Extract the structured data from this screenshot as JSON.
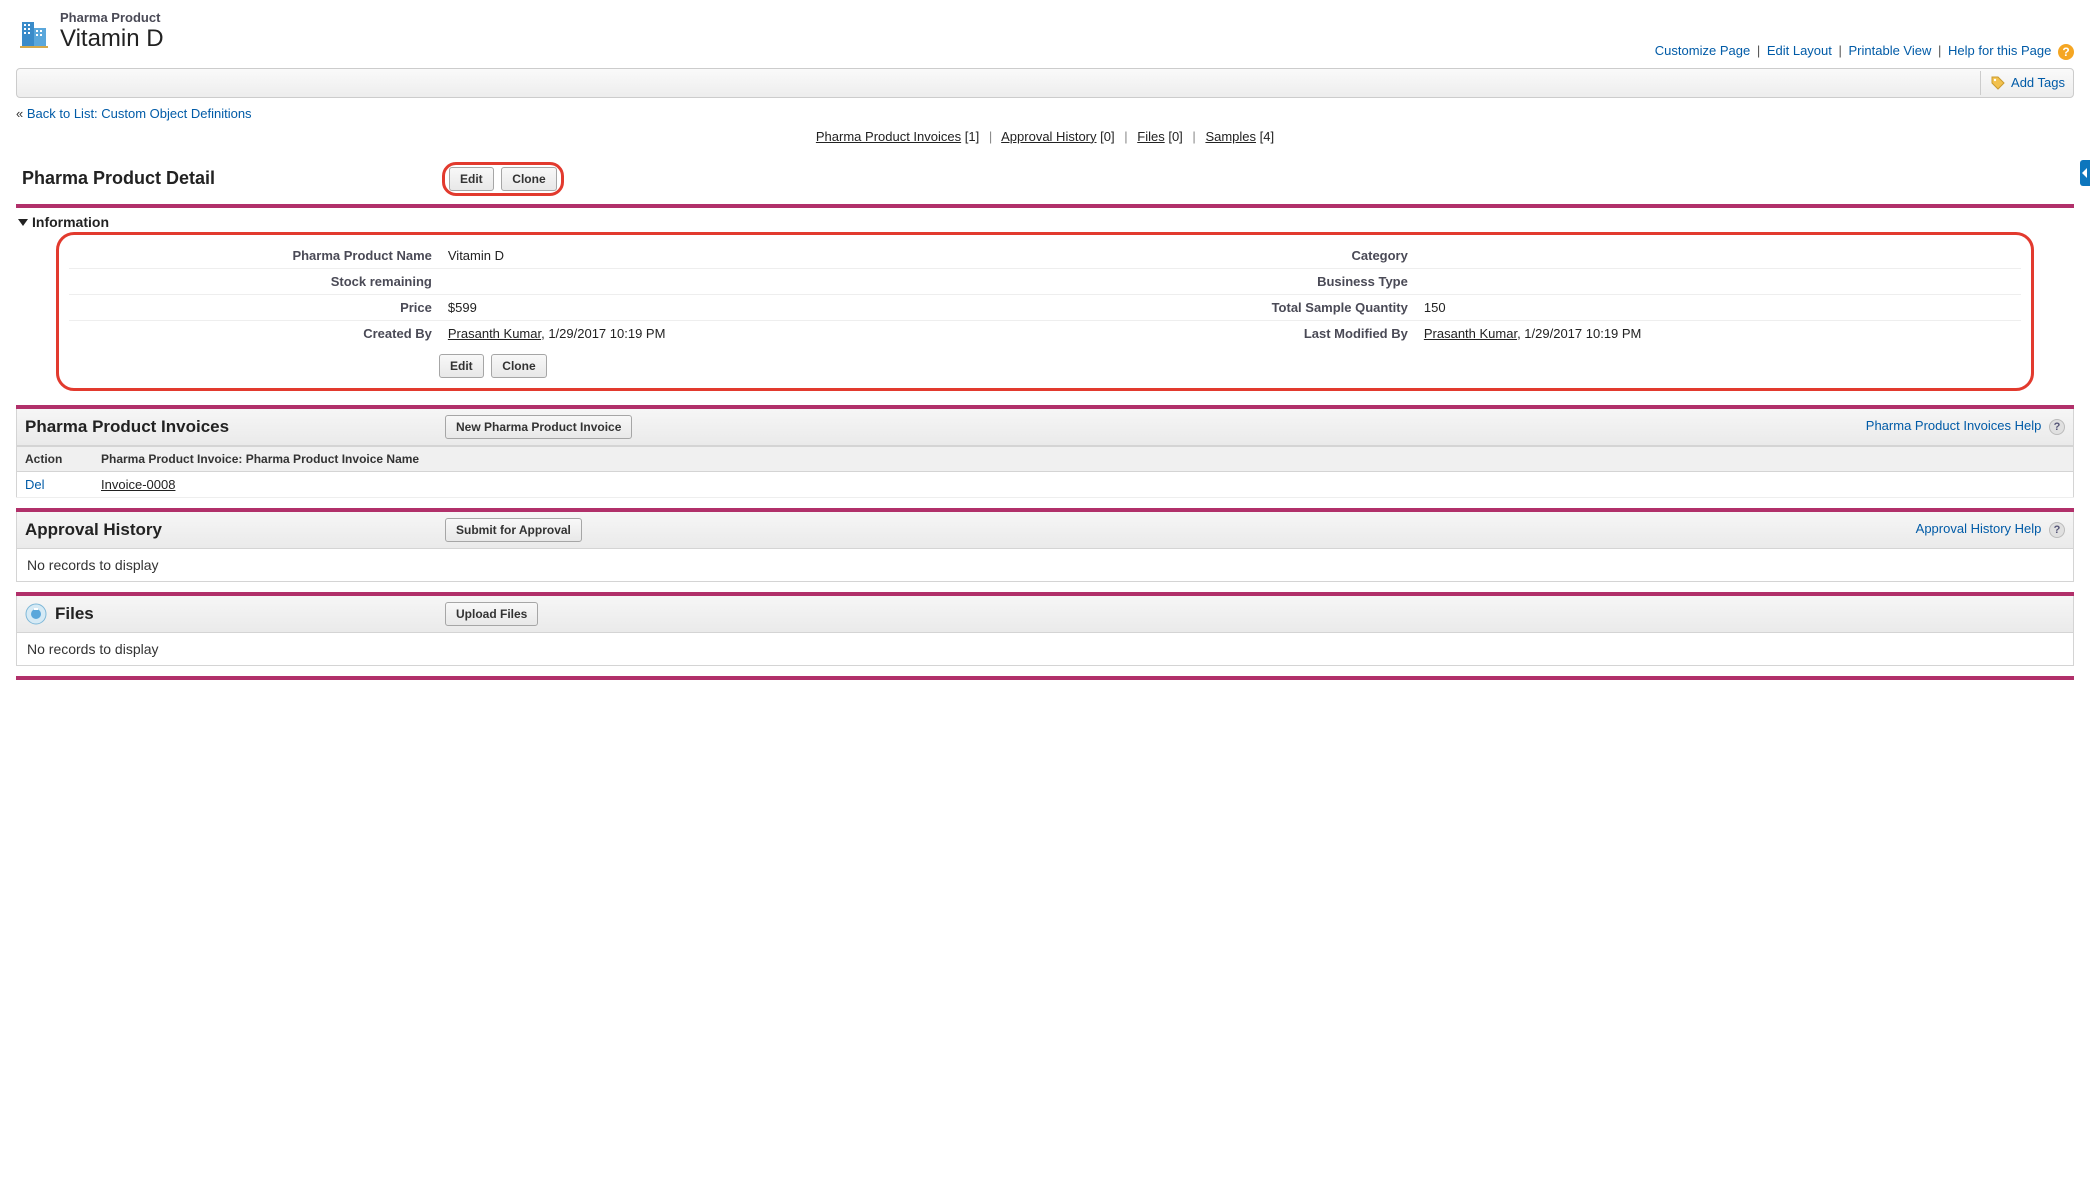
{
  "header": {
    "object_type": "Pharma Product",
    "record_name": "Vitamin D"
  },
  "top_links": {
    "customize": "Customize Page",
    "edit_layout": "Edit Layout",
    "printable": "Printable View",
    "help_page": "Help for this Page"
  },
  "tagbar": {
    "add_tags": "Add Tags"
  },
  "back_link": {
    "prefix": "«",
    "label": "Back to List: Custom Object Definitions"
  },
  "related_nav": [
    {
      "label": "Pharma Product Invoices",
      "count": "[1]"
    },
    {
      "label": "Approval History",
      "count": "[0]"
    },
    {
      "label": "Files",
      "count": "[0]"
    },
    {
      "label": "Samples",
      "count": "[4]"
    }
  ],
  "detail": {
    "section_title": "Pharma Product Detail",
    "edit_label": "Edit",
    "clone_label": "Clone",
    "info_header": "Information",
    "fields": {
      "name_label": "Pharma Product Name",
      "name_value": "Vitamin D",
      "category_label": "Category",
      "category_value": "",
      "stock_label": "Stock remaining",
      "stock_value": "",
      "biztype_label": "Business Type",
      "biztype_value": "",
      "price_label": "Price",
      "price_value": "$599",
      "tsq_label": "Total Sample Quantity",
      "tsq_value": "150",
      "created_label": "Created By",
      "created_user": "Prasanth Kumar",
      "created_rest": ", 1/29/2017 10:19 PM",
      "modified_label": "Last Modified By",
      "modified_user": "Prasanth Kumar",
      "modified_rest": ", 1/29/2017 10:19 PM"
    }
  },
  "related_invoices": {
    "title": "Pharma Product Invoices",
    "new_btn": "New Pharma Product Invoice",
    "help": "Pharma Product Invoices Help",
    "col_action": "Action",
    "col_name": "Pharma Product Invoice: Pharma Product Invoice Name",
    "rows": [
      {
        "action": "Del",
        "name": "Invoice-0008"
      }
    ]
  },
  "related_approval": {
    "title": "Approval History",
    "submit_btn": "Submit for Approval",
    "help": "Approval History Help",
    "no_records": "No records to display"
  },
  "related_files": {
    "title": "Files",
    "upload_btn": "Upload Files",
    "no_records": "No records to display"
  }
}
